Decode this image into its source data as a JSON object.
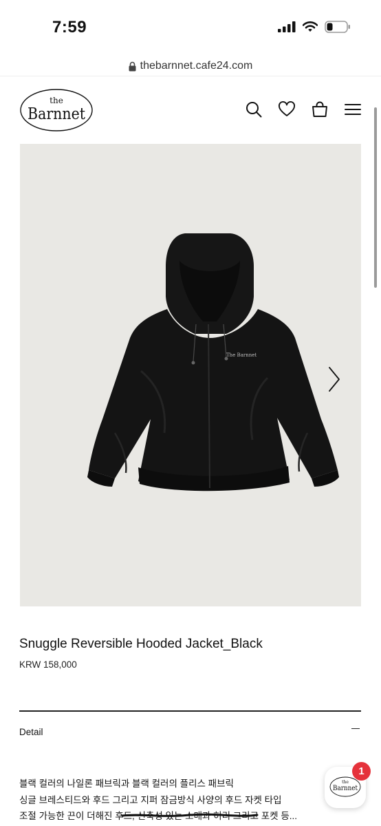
{
  "status_bar": {
    "time": "7:59"
  },
  "browser": {
    "url": "thebarnnet.cafe24.com"
  },
  "header": {
    "logo": {
      "top_text": "the",
      "main_text": "Barnnet"
    },
    "icons": [
      "search-icon",
      "heart-icon",
      "bag-icon",
      "menu-icon"
    ]
  },
  "product": {
    "name": "Snuggle Reversible Hooded Jacket_Black",
    "price": "KRW 158,000",
    "jacket_logo_text": "The Barnnet",
    "background_color": "#e9e8e4",
    "jacket_color": "#141414"
  },
  "detail": {
    "label": "Detail",
    "description_lines": [
      "블랙 컬러의 나일론 패브릭과 블랙 컬러의 플리스 패브릭",
      "싱글 브레스티드와 후드 그리고 지퍼 잠금방식 사양의 후드 자켓 타입",
      "조절 가능한 끈이 더해진 후드, 신축성 있는 소매과 허리 그리고 포켓 등..."
    ]
  },
  "chat_widget": {
    "badge_count": "1",
    "logo_top": "the",
    "logo_main": "Barnnet"
  },
  "colors": {
    "badge": "#e5323b",
    "text": "#111111"
  }
}
